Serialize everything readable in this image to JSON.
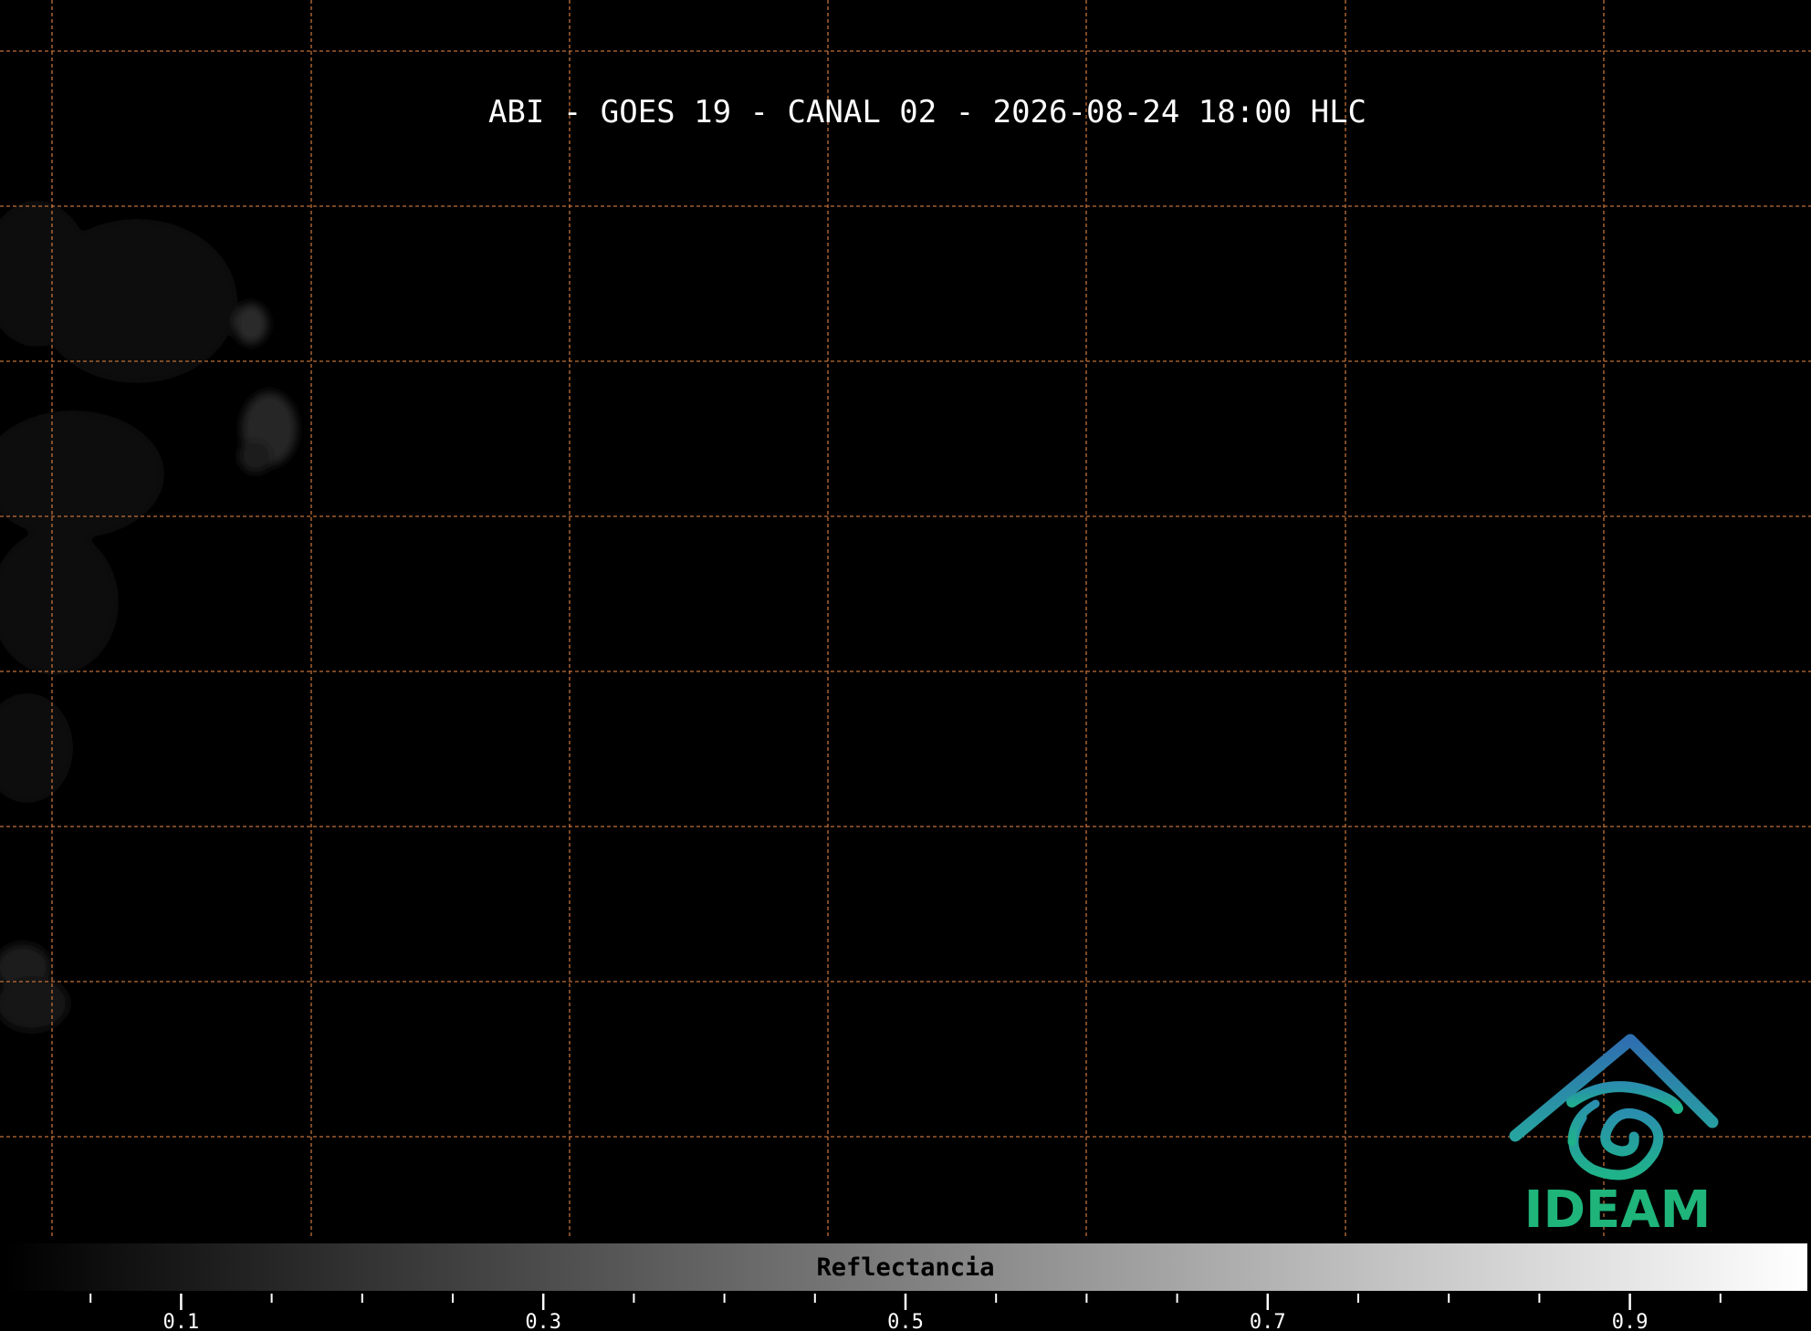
{
  "title": "ABI - GOES 19 - CANAL 02 - 2026-08-24 18:00 HLC",
  "logo": {
    "text": "IDEAM",
    "text_color": "#1eb47a",
    "roof_color_top": "#2f6fb0",
    "roof_color_bottom": "#27a3a0",
    "spiral_color": "#22a393"
  },
  "grid": {
    "color": "#c0703a",
    "style": "dashed"
  },
  "colorbar": {
    "label": "Reflectancia",
    "cmap": "gray",
    "range": [
      0.0,
      1.0
    ],
    "major_ticks": [
      {
        "value": 0.1,
        "label": "0.1"
      },
      {
        "value": 0.3,
        "label": "0.3"
      },
      {
        "value": 0.5,
        "label": "0.5"
      },
      {
        "value": 0.7,
        "label": "0.7"
      },
      {
        "value": 0.9,
        "label": "0.9"
      }
    ],
    "minor_ticks": [
      0.05,
      0.15,
      0.2,
      0.25,
      0.35,
      0.4,
      0.45,
      0.55,
      0.6,
      0.65,
      0.75,
      0.8,
      0.85,
      0.95
    ]
  },
  "background_color": "#000000"
}
